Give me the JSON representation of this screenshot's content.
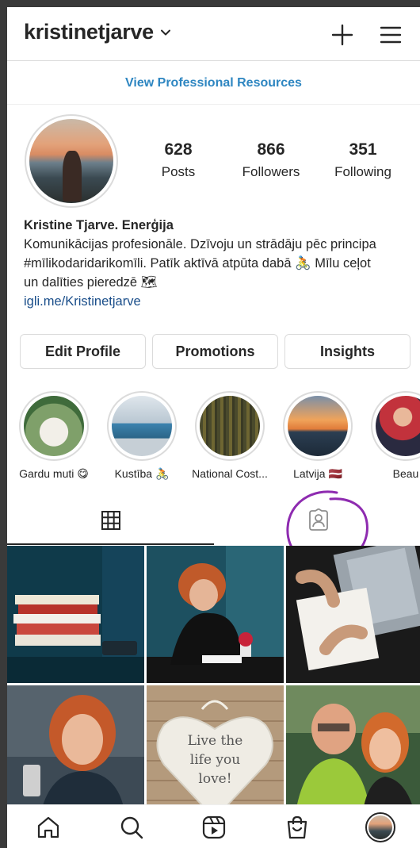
{
  "header": {
    "username": "kristinetjarve",
    "icons": [
      "chevron-down-icon",
      "plus-icon",
      "menu-icon"
    ]
  },
  "pro_banner": {
    "label": "View Professional Resources"
  },
  "profile": {
    "stats": [
      {
        "value": "628",
        "label": "Posts"
      },
      {
        "value": "866",
        "label": "Followers"
      },
      {
        "value": "351",
        "label": "Following"
      }
    ],
    "bio": {
      "name": "Kristine Tjarve. Enerģija",
      "line1": "Komunikācijas profesionāle. Dzīvoju un strādāju pēc principa",
      "line2": "#mīlikodaridarikomīli. Patīk aktīvā atpūta dabā 🚴 Mīlu ceļot",
      "line3": "un dalīties pieredzē 🗺",
      "link": "igli.me/Kristinetjarve"
    }
  },
  "buttons": {
    "edit_profile": "Edit Profile",
    "promotions": "Promotions",
    "insights": "Insights"
  },
  "highlights": [
    {
      "label": "Gardu muti 😋",
      "colors": [
        "#6b8f5a",
        "#e8e4dc"
      ]
    },
    {
      "label": "Kustība 🚴",
      "colors": [
        "#c8d3dc",
        "#3d7ea6"
      ]
    },
    {
      "label": "National Cost...",
      "colors": [
        "#4b4a2e",
        "#7a6f35"
      ]
    },
    {
      "label": "Latvija 🇱🇻",
      "colors": [
        "#f0a35a",
        "#2b3e52"
      ]
    },
    {
      "label": "Beau",
      "colors": [
        "#c2323c",
        "#2a2a40"
      ]
    }
  ],
  "tabs": {
    "grid": "grid-icon",
    "tagged": "tagged-person-icon"
  },
  "grid_posts": [
    {
      "id": "post-books",
      "overlay": ""
    },
    {
      "id": "post-desk-writing",
      "overlay": ""
    },
    {
      "id": "post-laptop-notes",
      "overlay": ""
    },
    {
      "id": "post-portrait-smile",
      "overlay": ""
    },
    {
      "id": "post-heart-sign",
      "line1": "Live the",
      "line2": "life you",
      "line3": "love!"
    },
    {
      "id": "post-selfie-couple",
      "overlay": ""
    }
  ],
  "bottom_nav": [
    "home-icon",
    "search-icon",
    "reels-icon",
    "shop-icon",
    "profile-avatar"
  ],
  "colors": {
    "annotation": "#8e2bb0",
    "link": "#1a4e8a",
    "banner_link": "#2e86c1"
  }
}
